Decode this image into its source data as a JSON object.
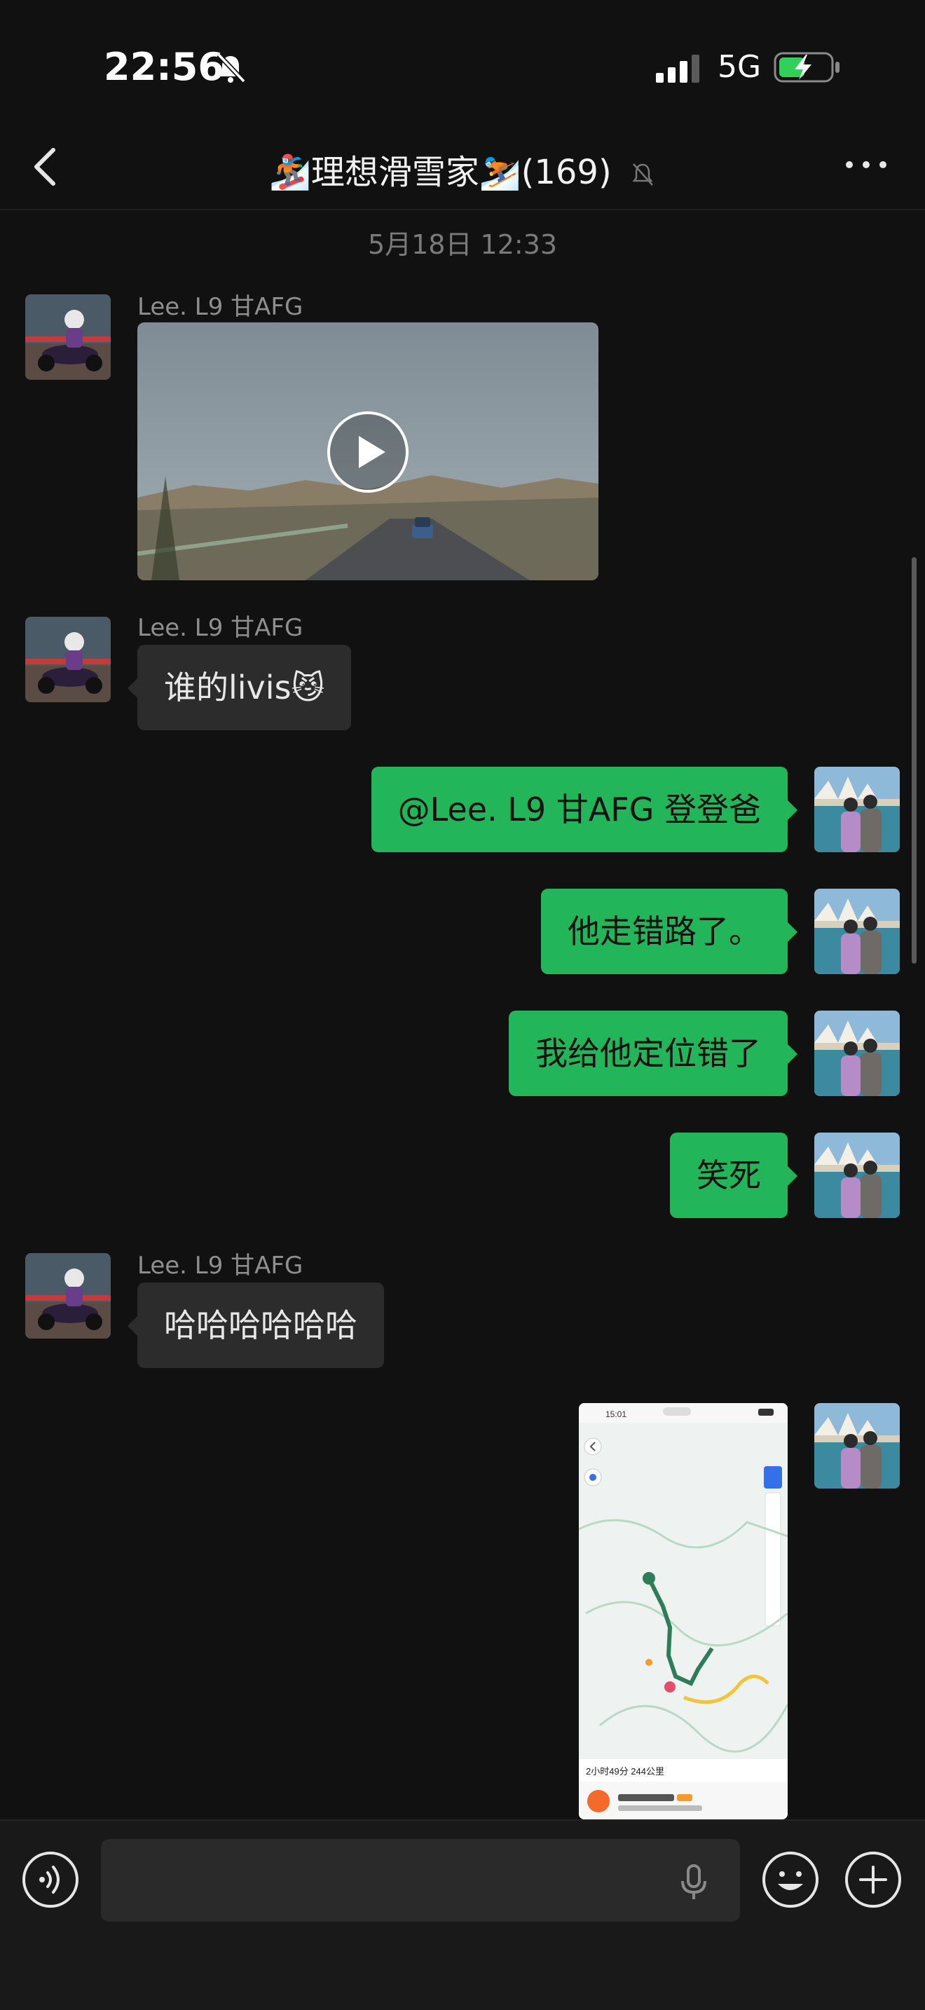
{
  "status_bar": {
    "time": "22:56",
    "network": "5G"
  },
  "header": {
    "title": "🏂理想滑雪家⛷️(169)"
  },
  "chat": {
    "timestamp": "5月18日 12:33",
    "messages": [
      {
        "sender": "Lee. L9 甘AFG",
        "type": "video"
      },
      {
        "sender": "Lee. L9 甘AFG",
        "text": "谁的livis😼"
      },
      {
        "text": "@Lee. L9 甘AFG 登登爸"
      },
      {
        "text": "他走错路了。"
      },
      {
        "text": "我给他定位错了"
      },
      {
        "text": "笑死"
      },
      {
        "sender": "Lee. L9 甘AFG",
        "text": "哈哈哈哈哈哈"
      },
      {
        "type": "image"
      }
    ]
  },
  "map_image": {
    "time": "15:01",
    "route_info": "2小时49分 244公里"
  },
  "colors": {
    "outgoing_bubble": "#23b55a",
    "incoming_bubble": "#2c2c2c",
    "background": "#111111"
  },
  "icons": [
    "back-icon",
    "more-icon",
    "mute-icon",
    "play-icon",
    "voice-icon",
    "mic-icon",
    "emoji-icon",
    "plus-icon"
  ]
}
